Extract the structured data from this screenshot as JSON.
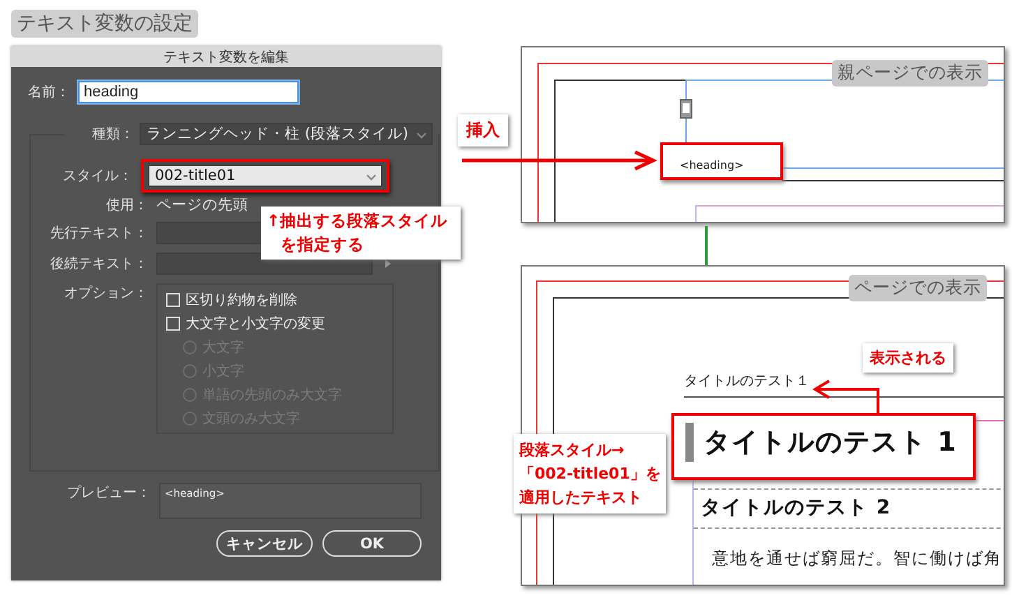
{
  "figure_title": "テキスト変数の設定",
  "dialog": {
    "title": "テキスト変数を編集",
    "name_label": "名前：",
    "name_value": "heading",
    "type_label": "種類：",
    "type_value": "ランニングヘッド・柱 (段落スタイル)",
    "style_label": "スタイル：",
    "style_value": "002-title01",
    "use_label": "使用：",
    "use_value": "ページの先頭",
    "before_label": "先行テキスト：",
    "after_label": "後続テキスト：",
    "options_label": "オプション：",
    "options": [
      {
        "kind": "checkbox",
        "label": "区切り約物を削除",
        "checked": false,
        "disabled": false
      },
      {
        "kind": "checkbox",
        "label": "大文字と小文字の変更",
        "checked": false,
        "disabled": false
      },
      {
        "kind": "radio",
        "label": "大文字",
        "selected": false,
        "disabled": true
      },
      {
        "kind": "radio",
        "label": "小文字",
        "selected": false,
        "disabled": true
      },
      {
        "kind": "radio",
        "label": "単語の先頭のみ大文字",
        "selected": false,
        "disabled": true
      },
      {
        "kind": "radio",
        "label": "文頭のみ大文字",
        "selected": false,
        "disabled": true
      }
    ],
    "preview_label": "プレビュー：",
    "preview_value": "<heading>",
    "buttons": [
      "キャンセル",
      "OK"
    ]
  },
  "style_callout": [
    "↑抽出する段落スタイル",
    "を指定する"
  ],
  "insert_label": "挿入",
  "parent_page": {
    "label": "親ページでの表示",
    "variable_text": "<heading>"
  },
  "page": {
    "label": "ページでの表示",
    "shown_label": "表示される",
    "running_head": "タイトルのテスト１",
    "heading1": "タイトルのテスト 1",
    "heading2": "タイトルのテスト 2",
    "body": "意地を通せば窮屈だ。智に働けば角",
    "applied_note": [
      "段落スタイル→",
      "「002-title01」を",
      "適用したテキスト"
    ]
  }
}
